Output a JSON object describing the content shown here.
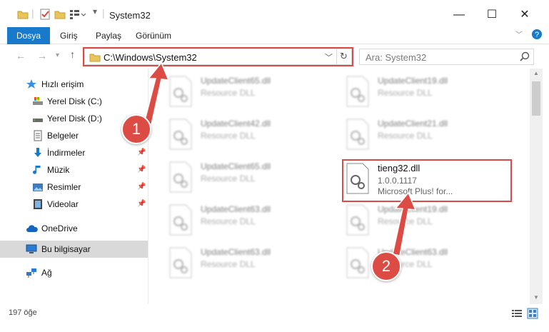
{
  "window": {
    "title": "System32"
  },
  "ribbon": {
    "tabs": [
      "Dosya",
      "Giriş",
      "Paylaş",
      "Görünüm"
    ]
  },
  "address": {
    "path": "C:\\Windows\\System32"
  },
  "search": {
    "placeholder": "Ara: System32"
  },
  "sidebar": {
    "items": [
      {
        "label": "Hızlı erişim"
      },
      {
        "label": "Yerel Disk (C:)"
      },
      {
        "label": "Yerel Disk (D:)"
      },
      {
        "label": "Belgeler"
      },
      {
        "label": "İndirmeler"
      },
      {
        "label": "Müzik"
      },
      {
        "label": "Resimler"
      },
      {
        "label": "Videolar"
      },
      {
        "label": "OneDrive"
      },
      {
        "label": "Bu bilgisayar"
      },
      {
        "label": "Ağ"
      }
    ]
  },
  "files": {
    "left": [
      {
        "name": "UpdateClient65.dll",
        "type": "Resource DLL"
      },
      {
        "name": "UpdateClient42.dll",
        "type": "Resource DLL"
      },
      {
        "name": "UpdateClient65.dll",
        "type": "Resource DLL"
      },
      {
        "name": "UpdateClient63.dll",
        "type": "Resource DLL"
      },
      {
        "name": "UpdateClient63.dll",
        "type": "Resource DLL"
      }
    ],
    "right": [
      {
        "name": "UpdateClient19.dll",
        "type": "Resource DLL"
      },
      {
        "name": "UpdateClient21.dll",
        "type": "Resource DLL"
      },
      {
        "name": "tieng32.dll",
        "version": "1.0.0.1117",
        "company": "Microsoft Plus! for..."
      },
      {
        "name": "UpdateClient19.dll",
        "type": "Resource DLL"
      },
      {
        "name": "UpdateClient63.dll",
        "type": "Resource DLL"
      }
    ]
  },
  "status": {
    "count": "197 öğe"
  },
  "annotations": {
    "step1": "1",
    "step2": "2"
  },
  "colors": {
    "accent": "#1979ca",
    "highlight": "#d94a4a",
    "badge": "#dd4c44"
  }
}
